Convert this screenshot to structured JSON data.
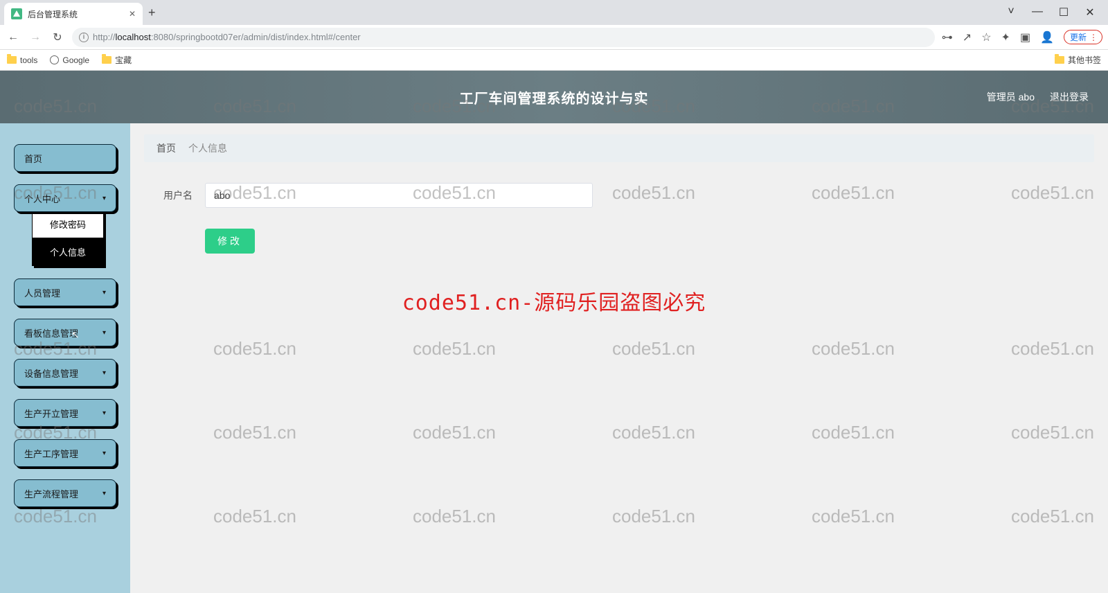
{
  "browser": {
    "tab_title": "后台管理系统",
    "url_prefix": "http://",
    "url_host": "localhost",
    "url_port_path": ":8080/springbootd07er/admin/dist/index.html#/center",
    "update_label": "更新",
    "bookmarks": {
      "tools": "tools",
      "google": "Google",
      "treasure": "宝藏",
      "other": "其他书签"
    }
  },
  "header": {
    "title": "工厂车间管理系统的设计与实",
    "user_label": "管理员 abo",
    "logout": "退出登录"
  },
  "sidebar": {
    "home": "首页",
    "personal": "个人中心",
    "sub_change_pw": "修改密码",
    "sub_profile": "个人信息",
    "staff": "人员管理",
    "board": "看板信息管理",
    "device": "设备信息管理",
    "production_open": "生产开立管理",
    "process_mgmt": "生产工序管理",
    "flow_mgmt": "生产流程管理"
  },
  "breadcrumb": {
    "home": "首页",
    "current": "个人信息"
  },
  "form": {
    "username_label": "用户名",
    "username_value": "abo",
    "submit": "修改"
  },
  "watermark": {
    "text": "code51.cn",
    "center": "code51.cn-源码乐园盗图必究"
  }
}
